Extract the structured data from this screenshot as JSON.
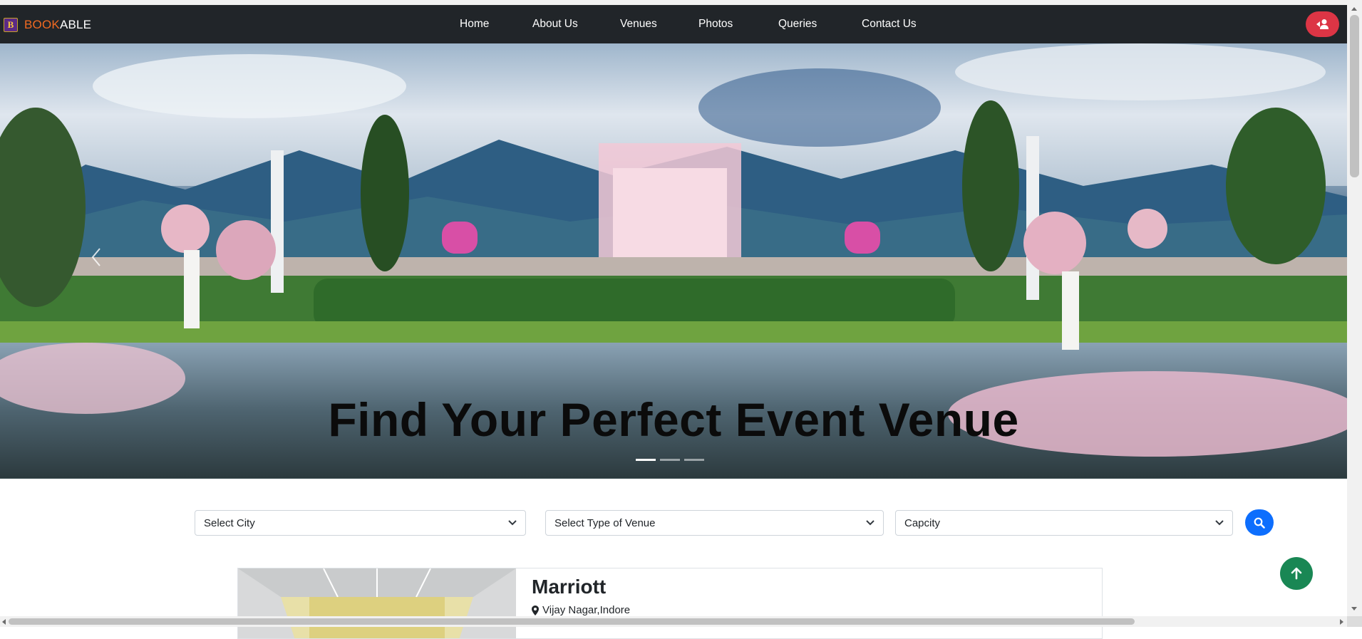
{
  "navbar": {
    "brand_badge": "B",
    "brand_part1": "BOOK",
    "brand_part2": "ABLE",
    "links": [
      {
        "label": "Home"
      },
      {
        "label": "About Us"
      },
      {
        "label": "Venues"
      },
      {
        "label": "Photos"
      },
      {
        "label": "Queries"
      },
      {
        "label": "Contact Us"
      }
    ],
    "user_icon": "user-login-icon",
    "bg_color": "#212529",
    "brand_color": "#f26a21"
  },
  "hero": {
    "title": "Find Your Perfect Event Venue",
    "slide_count": 3,
    "active_slide": 1,
    "prev_icon": "chevron-left-icon"
  },
  "search": {
    "city_placeholder": "Select City",
    "type_placeholder": "Select Type of Venue",
    "capacity_placeholder": "Capcity",
    "button_icon": "search-icon",
    "button_color": "#0d6efd"
  },
  "venues": [
    {
      "name": "Marriott",
      "location": "Vijay Nagar,Indore",
      "location_icon": "map-marker-icon"
    }
  ],
  "back_to_top": {
    "icon": "arrow-up-icon",
    "color": "#198754"
  },
  "user_button_color": "#dc3545"
}
